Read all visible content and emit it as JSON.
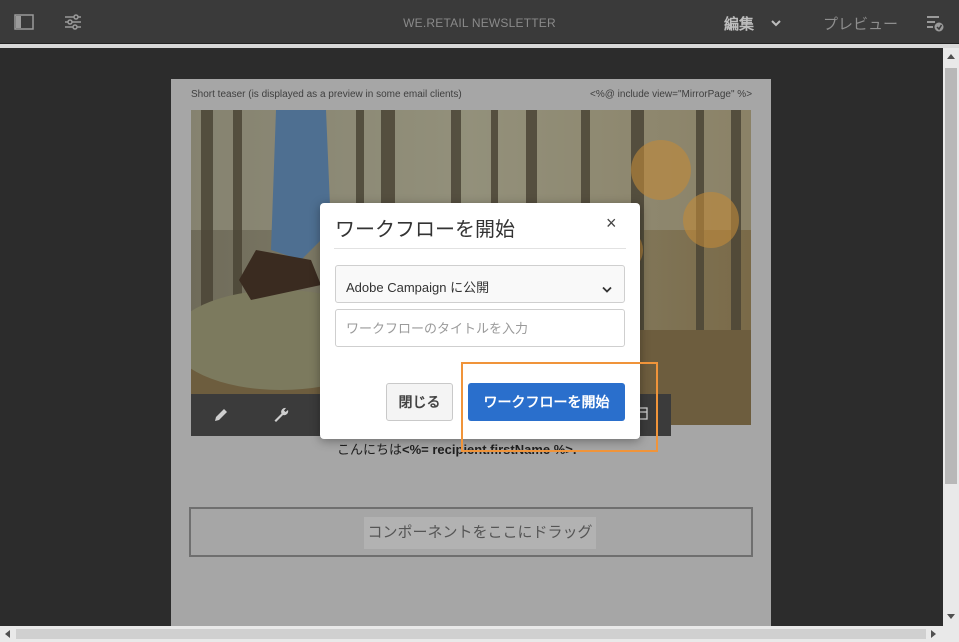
{
  "topbar": {
    "title": "WE.RETAIL NEWSLETTER",
    "edit_label": "編集",
    "preview_label": "プレビュー",
    "icons": [
      "side-panel-icon",
      "properties-icon",
      "chevron-down-icon",
      "publish-icon"
    ]
  },
  "page": {
    "teaser_text": "Short teaser (is displayed as a preview in some email clients)",
    "mirror_text": "<%@ include view=\"MirrorPage\" %>",
    "greeting_prefix": "こんにちは",
    "greeting_code": "<%= recipient.firstName %>.",
    "dropzone_label": "コンポーネントをここにドラッグ"
  },
  "component_toolbar": {
    "icons": [
      "pencil-icon",
      "wrench-icon"
    ]
  },
  "dialog": {
    "title": "ワークフローを開始",
    "close_glyph": "×",
    "workflow_select_value": "Adobe Campaign に公開",
    "title_input_placeholder": "ワークフローのタイトルを入力",
    "title_input_value": "",
    "close_button_label": "閉じる",
    "start_button_label": "ワークフローを開始"
  },
  "colors": {
    "primary_button": "#2a6fcc",
    "highlight": "#f0943a",
    "topbar": "#3a3a3a"
  }
}
